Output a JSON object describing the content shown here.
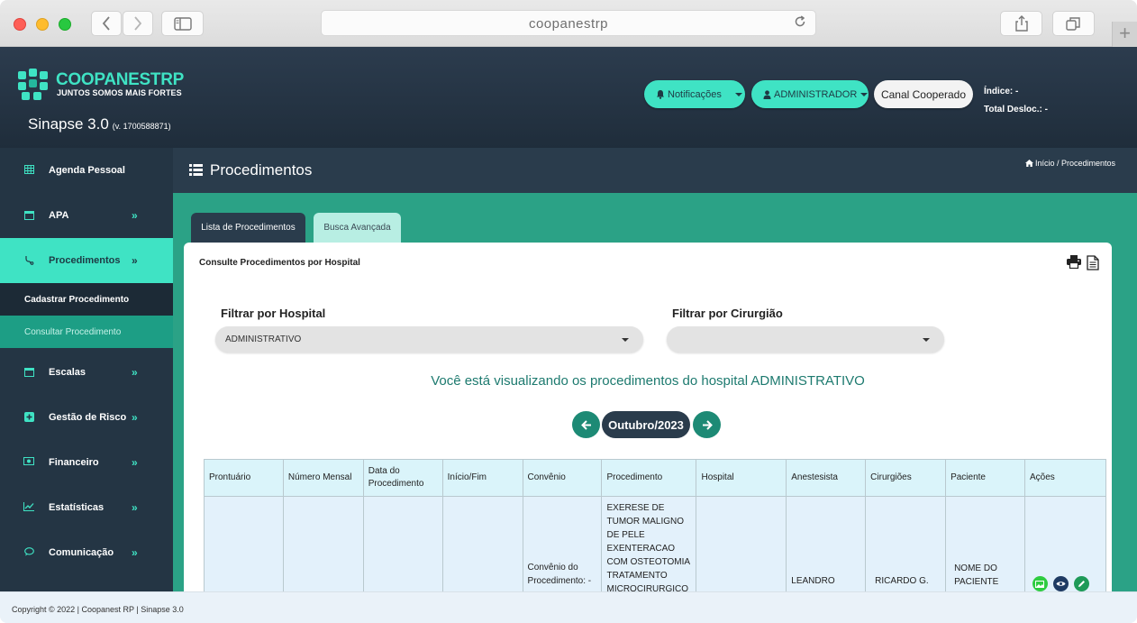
{
  "browser": {
    "url": "coopanestrp",
    "back_icon": "chevron-left-icon",
    "forward_icon": "chevron-right-icon",
    "sidebar_icon": "sidebar-icon",
    "reload_icon": "reload-icon",
    "share_icon": "share-icon",
    "tabs_icon": "tabs-icon",
    "new_tab_icon": "plus-icon"
  },
  "brand": {
    "name_part1": "COOPANEST",
    "name_part2": "RP",
    "tagline": "JUNTOS SOMOS MAIS FORTES",
    "app_name": "Sinapse 3.0",
    "version": "(v. 1700588871)",
    "accent": "#3fe3c4"
  },
  "header": {
    "notifications_label": "Notificações",
    "admin_label": "ADMINISTRADOR",
    "canal_label": "Canal Cooperado",
    "indice_label": "Índice: -",
    "total_desloc_label": "Total Desloc.: -"
  },
  "sidebar": {
    "items": [
      {
        "label": "Agenda Pessoal",
        "icon": "calendar-grid-icon"
      },
      {
        "label": "APA",
        "icon": "calendar-icon"
      },
      {
        "label": "Procedimentos",
        "icon": "stethoscope-icon"
      },
      {
        "label": "Escalas",
        "icon": "calendar-icon"
      },
      {
        "label": "Gestão de Risco",
        "icon": "plus-square-icon"
      },
      {
        "label": "Financeiro",
        "icon": "money-icon"
      },
      {
        "label": "Estatísticas",
        "icon": "chart-line-icon"
      },
      {
        "label": "Comunicação",
        "icon": "chat-icon"
      }
    ],
    "subitems": [
      {
        "label": "Cadastrar Procedimento"
      },
      {
        "label": "Consultar Procedimento"
      }
    ],
    "chevron": "»"
  },
  "page": {
    "title": "Procedimentos",
    "breadcrumb": "Início / Procedimentos",
    "tabs": [
      {
        "label": "Lista de Procedimentos"
      },
      {
        "label": "Busca Avançada"
      }
    ],
    "panel_title": "Consulte Procedimentos por Hospital",
    "filter_hospital_label": "Filtrar por Hospital",
    "filter_hospital_value": "ADMINISTRATIVO",
    "filter_cirurgiao_label": "Filtrar por Cirurgião",
    "filter_cirurgiao_value": "",
    "viewing_text": "Você está visualizando os procedimentos do hospital ADMINISTRATIVO",
    "month": "Outubro/2023"
  },
  "table": {
    "headers": [
      "Prontuário",
      "Número Mensal",
      "Data do Procedimento",
      "Início/Fim",
      "Convênio",
      "Procedimento",
      "Hospital",
      "Anestesista",
      "Cirurgiões",
      "Paciente",
      "Ações"
    ],
    "rows": [
      {
        "prontuario": "",
        "numero_mensal": "",
        "data": "",
        "inicio_fim": "",
        "convenio": "Convênio do Procedimento: -",
        "procedimento": "EXERESE DE TUMOR MALIGNO DE PELE EXENTERACAO COM OSTEOTOMIA TRATAMENTO MICROCIRURGICO",
        "hospital": "",
        "anestesista": "LEANDRO",
        "cirurgioes": "RICARDO G.",
        "paciente": "NOME DO PACIENTE"
      }
    ]
  },
  "footer": {
    "copyright": "Copyright © 2022 | Coopanest RP | Sinapse 3.0"
  }
}
